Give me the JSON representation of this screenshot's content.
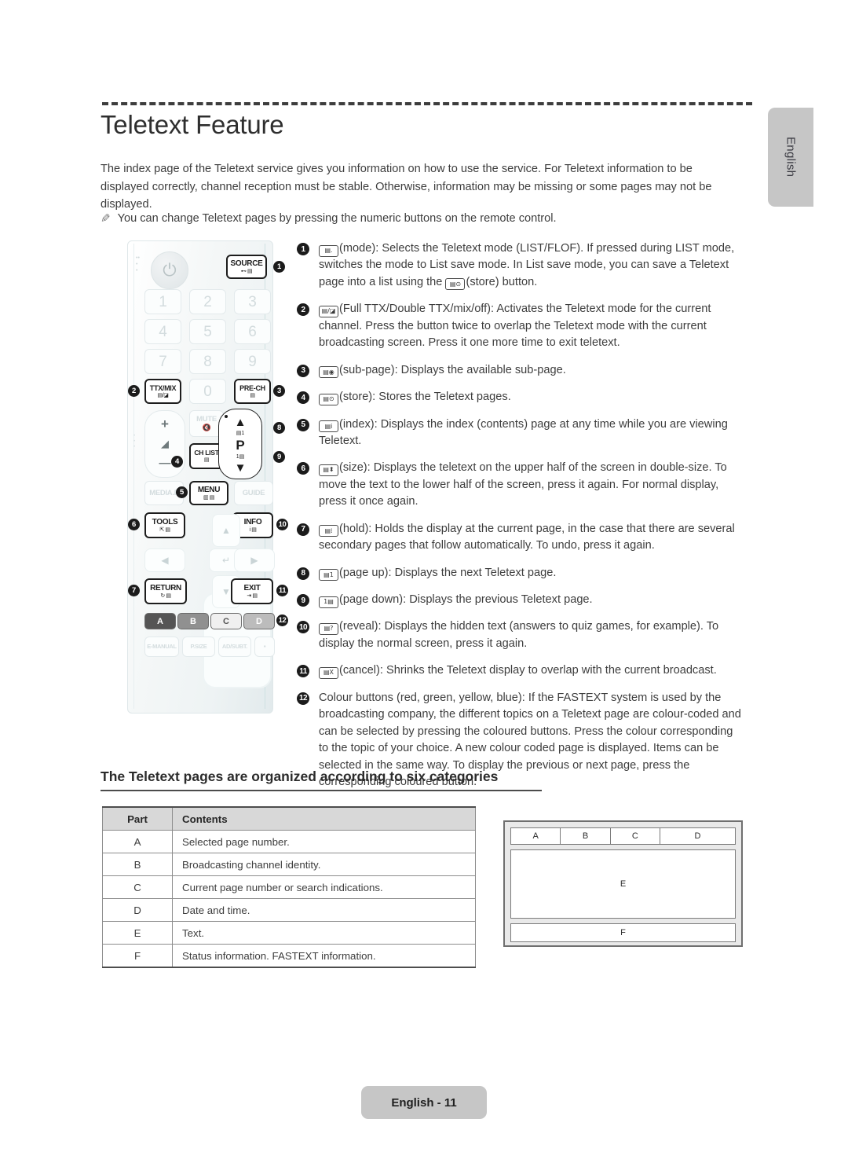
{
  "side_tab": {
    "label": "English"
  },
  "header": {
    "title": "Teletext Feature",
    "intro": "The index page of the Teletext service gives you information on how to use the service. For Teletext information to be displayed correctly, channel reception must be stable. Otherwise, information may be missing or some pages may not be displayed.",
    "note_icon": "pencil-note-icon",
    "note": "You can change Teletext pages by pressing the numeric buttons on the remote control."
  },
  "remote": {
    "power_icon": "power-icon",
    "numeric_keys": [
      "1",
      "2",
      "3",
      "4",
      "5",
      "6",
      "7",
      "8",
      "9",
      "0"
    ],
    "buttons": {
      "source": {
        "label": "SOURCE",
        "sub": "⊷ ▤"
      },
      "ttxmix": {
        "label": "TTX/MIX",
        "sub": "▤/◪"
      },
      "prech": {
        "label": "PRE-CH",
        "sub": "▤"
      },
      "mute": {
        "label": "MUTE",
        "sub": "🔇"
      },
      "chlist": {
        "label": "CH LIST",
        "sub": "▤"
      },
      "media": {
        "label": "MEDIA.P"
      },
      "menu": {
        "label": "MENU",
        "sub": "▥ ▤"
      },
      "guide": {
        "label": "GUIDE"
      },
      "tools": {
        "label": "TOOLS",
        "sub": "⇱ ▤"
      },
      "info": {
        "label": "INFO",
        "sub": "i ▤"
      },
      "return": {
        "label": "RETURN",
        "sub": "↻ ▤"
      },
      "exit": {
        "label": "EXIT",
        "sub": "⇥ ▤"
      },
      "p_label": "P",
      "plus": "+",
      "minus": "—",
      "vol_icon": "volume-icon"
    },
    "colour_buttons": [
      {
        "label": "A",
        "bg": "#555555",
        "fg": "#ffffff"
      },
      {
        "label": "B",
        "bg": "#909090",
        "fg": "#ffffff"
      },
      {
        "label": "C",
        "bg": "#f0f0f0",
        "fg": "#555555"
      },
      {
        "label": "D",
        "bg": "#bcbcbc",
        "fg": "#ffffff"
      }
    ],
    "bottom_row": [
      "E-MANUAL",
      "P.SIZE",
      "AD/SUBT.",
      "▪"
    ],
    "callouts": [
      "1",
      "2",
      "3",
      "4",
      "5",
      "6",
      "7",
      "8",
      "9",
      "10",
      "11",
      "12"
    ]
  },
  "descriptions": [
    {
      "num": "1",
      "glyph": "▤.",
      "text": "(mode): Selects the Teletext mode (LIST/FLOF). If pressed during LIST mode, switches the mode to List save mode. In List save mode, you can save a Teletext page into a list using the",
      "glyph2": "▤⊙",
      "text2": "(store) button."
    },
    {
      "num": "2",
      "glyph": "▤/◪",
      "text": "(Full TTX/Double TTX/mix/off): Activates the Teletext mode for the current channel. Press the button twice to overlap the Teletext mode with the current broadcasting screen. Press it one more time to exit teletext."
    },
    {
      "num": "3",
      "glyph": "▤◉",
      "text": "(sub-page): Displays the available sub-page."
    },
    {
      "num": "4",
      "glyph": "▤⊙",
      "text": "(store): Stores the Teletext pages."
    },
    {
      "num": "5",
      "glyph": "▤i",
      "text": "(index): Displays the index (contents) page at any time while you are viewing Teletext."
    },
    {
      "num": "6",
      "glyph": "▤⬍",
      "text": "(size): Displays the teletext on the upper half of the screen in double-size. To move the text to the lower half of the screen, press it again. For normal display, press it once again."
    },
    {
      "num": "7",
      "glyph": "▤⁞",
      "text": "(hold): Holds the display at the current page, in the case that there are several secondary pages that follow automatically. To undo, press it again."
    },
    {
      "num": "8",
      "glyph": "▤1",
      "text": "(page up): Displays the next Teletext page."
    },
    {
      "num": "9",
      "glyph": "1▤",
      "text": "(page down): Displays the previous Teletext page."
    },
    {
      "num": "10",
      "glyph": "▤?",
      "text": "(reveal): Displays the hidden text (answers to quiz games, for example). To display the normal screen, press it again."
    },
    {
      "num": "11",
      "glyph": "▤X",
      "text": "(cancel): Shrinks the Teletext display to overlap with the current broadcast."
    },
    {
      "num": "12",
      "glyph": "",
      "text": "Colour buttons (red, green, yellow, blue): If the FASTEXT system is used by the broadcasting company, the different topics on a Teletext page are colour-coded and can be selected by pressing the coloured buttons. Press the colour corresponding to the topic of your choice. A new colour coded page is displayed. Items can be selected in the same way. To display the previous or next page, press the corresponding coloured button."
    }
  ],
  "section": {
    "heading": "The Teletext pages are organized according to six categories"
  },
  "table": {
    "columns": [
      "Part",
      "Contents"
    ],
    "rows": [
      [
        "A",
        "Selected page number."
      ],
      [
        "B",
        "Broadcasting channel identity."
      ],
      [
        "C",
        "Current page number or search indications."
      ],
      [
        "D",
        "Date and time."
      ],
      [
        "E",
        "Text."
      ],
      [
        "F",
        "Status information. FASTEXT information."
      ]
    ]
  },
  "diagram": {
    "top_cells": [
      "A",
      "B",
      "C",
      "D"
    ],
    "middle_cell": "E",
    "bottom_cell": "F"
  },
  "footer": {
    "label": "English - 11"
  }
}
